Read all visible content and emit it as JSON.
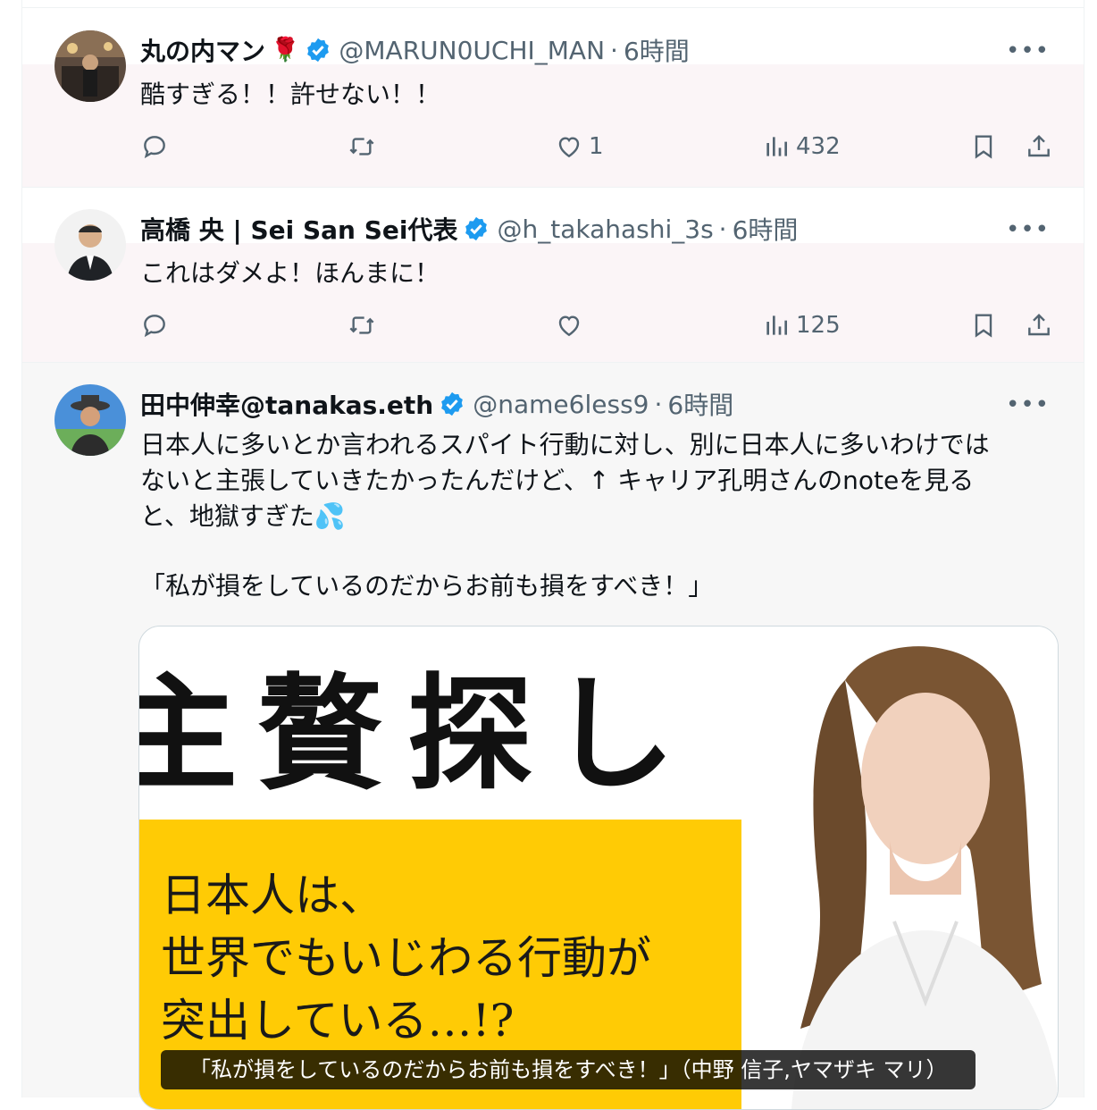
{
  "tweets": [
    {
      "name": "丸の内マン",
      "emoji": "🌹",
      "handle": "@MARUN0UCHI_MAN",
      "time": "6時間",
      "text": "酷すぎる！！許せない！！",
      "likes": "1",
      "views": "432"
    },
    {
      "name": "高橋 央 | Sei San Sei代表",
      "handle": "@h_takahashi_3s",
      "time": "6時間",
      "text": "これはダメよ！ほんまに！",
      "views": "125"
    },
    {
      "name": "田中伸幸@tanakas.eth",
      "handle": "@name6less9",
      "time": "6時間",
      "text_lines": [
        "日本人に多いとか言われるスパイト行動に対し、別に日本人に多いわけでは",
        "ないと主張していきたかったんだけど、↑ キャリア孔明さんのnoteを見る",
        "と、地獄すぎた💦"
      ],
      "quote": "「私が損をしているのだからお前も損をすべき！」",
      "image": {
        "big_chars": [
          "主",
          "贅",
          "探",
          "し"
        ],
        "yellow_lines": [
          "日本人は、",
          "世界でもいじわる行動が",
          "突出している…!?"
        ],
        "caption": "「私が損をしているのだからお前も損をすべき！」（中野 信子,ヤマザキ マリ）"
      }
    }
  ],
  "more_label": "•••",
  "colors": {
    "verified": "#1d9bf0",
    "muted": "#536471",
    "yellow": "#ffcb05"
  }
}
